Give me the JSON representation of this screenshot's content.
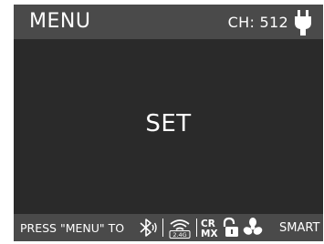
{
  "header": {
    "title": "MENU",
    "channel": "CH: 512",
    "power_icon": "plug-icon"
  },
  "main": {
    "label": "SET"
  },
  "footer": {
    "hint": "PRESS \"MENU\" TO",
    "icons": [
      "bluetooth-icon",
      "wireless-2.4g-icon",
      "crmx-icon",
      "lock-icon",
      "fan-icon"
    ],
    "wireless_band": "2.4G",
    "crmx_text": [
      "CR",
      "MX"
    ],
    "smart_label": "SMART"
  }
}
